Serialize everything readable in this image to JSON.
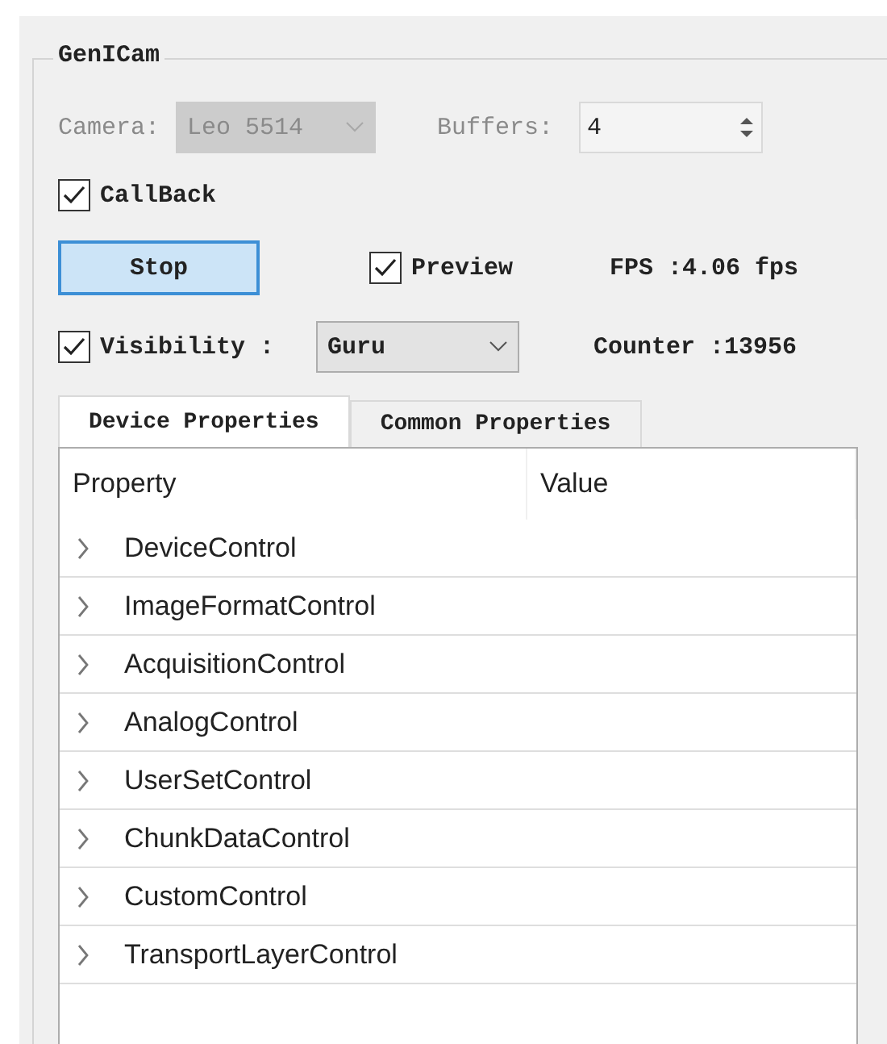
{
  "group": {
    "title": "GenICam"
  },
  "camera": {
    "label": "Camera:",
    "value": "Leo 5514",
    "disabled": true
  },
  "buffers": {
    "label": "Buffers:",
    "value": "4"
  },
  "callback": {
    "label": "CallBack",
    "checked": true
  },
  "stop_button": "Stop",
  "preview": {
    "label": "Preview",
    "checked": true
  },
  "fps": "FPS :4.06 fps",
  "visibility": {
    "label": "Visibility :",
    "checked": true,
    "value": "Guru"
  },
  "counter": "Counter :13956",
  "tabs": [
    {
      "label": "Device Properties",
      "selected": true
    },
    {
      "label": "Common Properties",
      "selected": false
    }
  ],
  "table": {
    "columns": [
      "Property",
      "Value"
    ],
    "rows": [
      {
        "name": "DeviceControl",
        "expanded": false
      },
      {
        "name": "ImageFormatControl",
        "expanded": false
      },
      {
        "name": "AcquisitionControl",
        "expanded": false
      },
      {
        "name": "AnalogControl",
        "expanded": false
      },
      {
        "name": "UserSetControl",
        "expanded": false
      },
      {
        "name": "ChunkDataControl",
        "expanded": false
      },
      {
        "name": "CustomControl",
        "expanded": false
      },
      {
        "name": "TransportLayerControl",
        "expanded": false
      }
    ]
  }
}
